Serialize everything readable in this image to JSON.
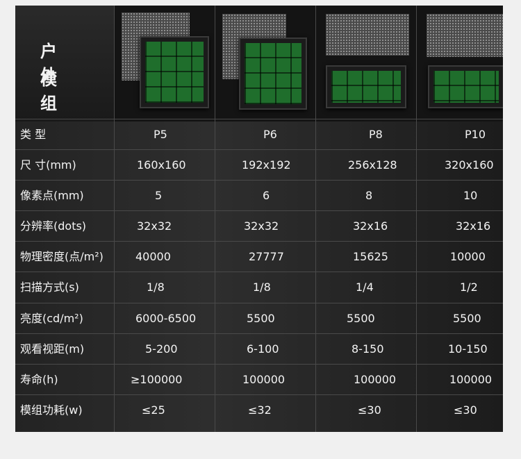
{
  "corner": {
    "line1": "户 外",
    "line2": "模 组"
  },
  "images": [
    {
      "alt": "P5 module photo"
    },
    {
      "alt": "P6 module photo"
    },
    {
      "alt": "P8 module photo"
    },
    {
      "alt": "P10 module photo"
    }
  ],
  "table": {
    "rows": [
      {
        "label": "类 型",
        "values": [
          "P5",
          "P6",
          "P8",
          "P10"
        ]
      },
      {
        "label": "尺 寸(mm)",
        "values": [
          "160x160",
          "192x192",
          "256x128",
          "320x160"
        ]
      },
      {
        "label": "像素点(mm)",
        "values": [
          "5",
          "6",
          "8",
          "10"
        ]
      },
      {
        "label": "分辨率(dots)",
        "values": [
          "32x32",
          "32x32",
          "32x16",
          "32x16"
        ]
      },
      {
        "label": "物理密度(点/m²)",
        "values": [
          "40000",
          "27777",
          "15625",
          "10000"
        ]
      },
      {
        "label": "扫描方式(s)",
        "values": [
          "1/8",
          "1/8",
          "1/4",
          "1/2"
        ]
      },
      {
        "label": "亮度(cd/m²)",
        "values": [
          "6000-6500",
          "5500",
          "5500",
          "5500"
        ]
      },
      {
        "label": "观看视距(m)",
        "values": [
          "5-200",
          "6-100",
          "8-150",
          "10-150"
        ]
      },
      {
        "label": "寿命(h)",
        "values": [
          "≥100000",
          "100000",
          "100000",
          "100000"
        ]
      },
      {
        "label": "模组功耗(w)",
        "values": [
          "≤25",
          "≤32",
          "≤30",
          "≤30"
        ]
      }
    ]
  }
}
